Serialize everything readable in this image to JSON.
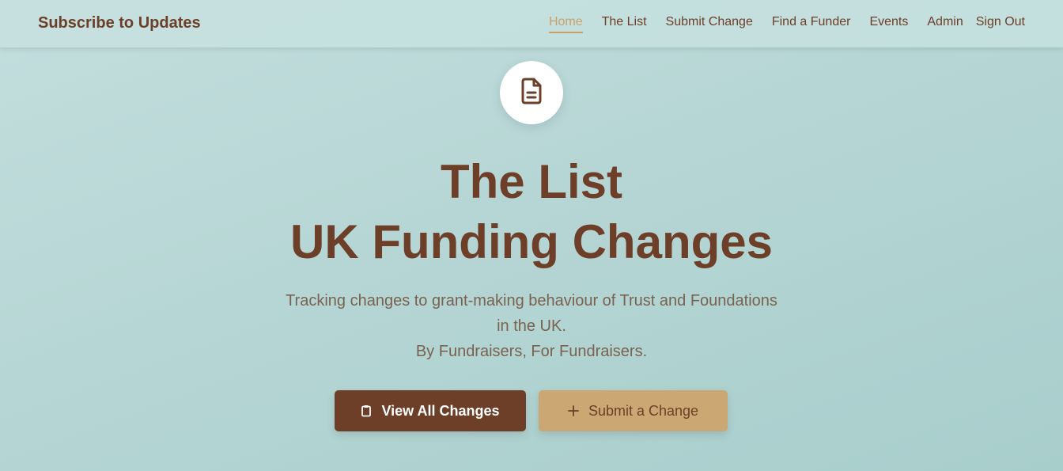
{
  "navbar": {
    "brand": "Subscribe to Updates",
    "items": [
      {
        "label": "Home",
        "active": true
      },
      {
        "label": "The List"
      },
      {
        "label": "Submit Change"
      },
      {
        "label": "Find a Funder"
      },
      {
        "label": "Events"
      },
      {
        "label": "Admin"
      }
    ],
    "sign_out": "Sign Out"
  },
  "hero": {
    "icon": "document-icon",
    "title_line1": "The List",
    "title_line2": "UK Funding Changes",
    "subtitle_line1": "Tracking changes to grant-making behaviour of Trust and Foundations",
    "subtitle_line2": "in the UK.",
    "subtitle_line3": "By Fundraisers, For Fundraisers."
  },
  "actions": {
    "view_all": {
      "label": "View All Changes",
      "icon": "clipboard-icon"
    },
    "submit": {
      "label": "Submit a Change",
      "icon": "plus-icon"
    }
  },
  "colors": {
    "brand_brown": "#6d3f28",
    "accent_tan": "#cba774",
    "active_link": "#c9a16b",
    "background": "#b6d6d5"
  }
}
